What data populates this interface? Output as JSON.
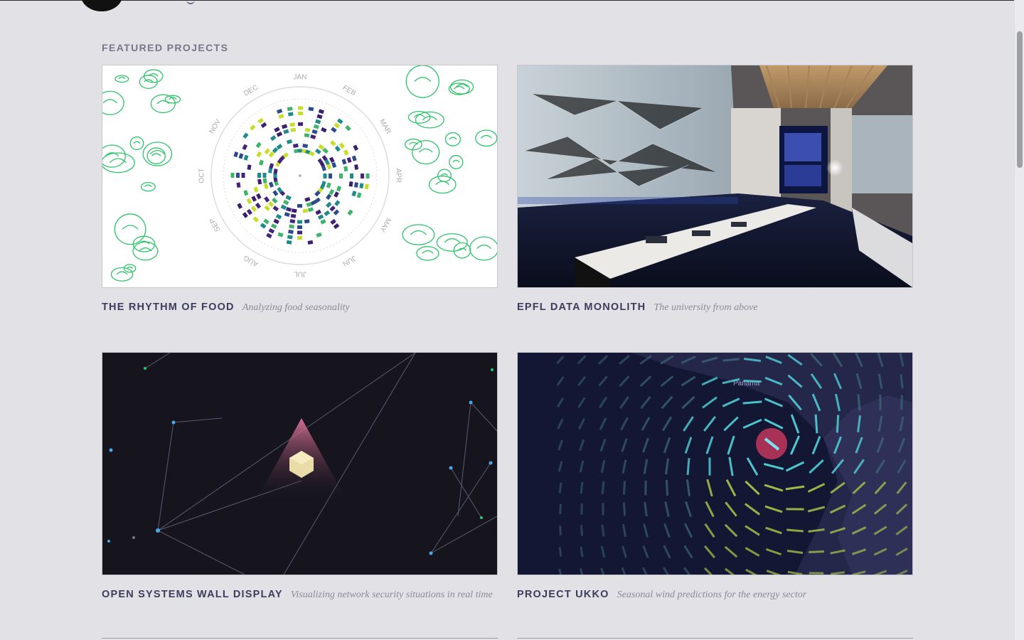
{
  "section": {
    "title": "FEATURED PROJECTS"
  },
  "projects": [
    {
      "title": "THE RHYTHM OF FOOD",
      "subtitle": "Analyzing food seasonality"
    },
    {
      "title": "EPFL DATA MONOLITH",
      "subtitle": "The university from above"
    },
    {
      "title": "OPEN SYSTEMS WALL DISPLAY",
      "subtitle": "Visualizing network security situations in real time"
    },
    {
      "title": "PROJECT UKKO",
      "subtitle": "Seasonal wind predictions for the energy sector"
    }
  ],
  "food": {
    "months": [
      "JAN",
      "FEB",
      "MAR",
      "APR",
      "MAY",
      "JUN",
      "JUL",
      "AUG",
      "SEP",
      "OCT",
      "NOV",
      "DEC"
    ]
  },
  "ukko": {
    "map_label": "Panama"
  },
  "colors": {
    "background": "#e2e1e6",
    "title": "#3d3c5c",
    "subtitle": "#8a8a9a",
    "food_green": "#2ec56a",
    "ukko_accent": "#c0395e"
  }
}
